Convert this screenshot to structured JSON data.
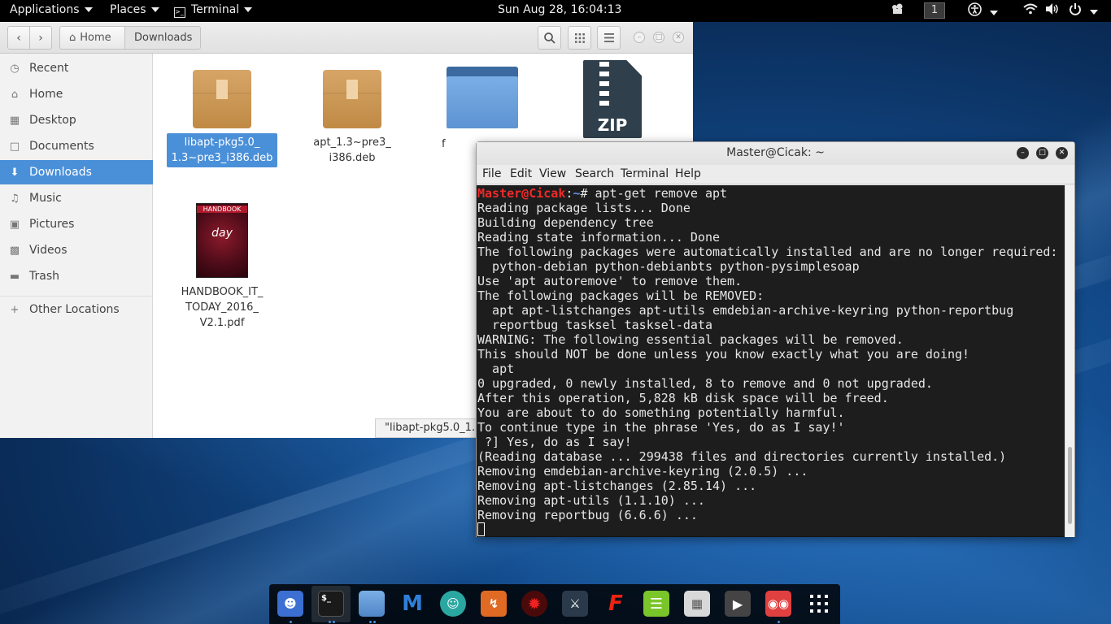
{
  "topbar": {
    "applications": "Applications",
    "places": "Places",
    "terminal": "Terminal",
    "clock": "Sun Aug 28, 16:04:13",
    "workspace": "1"
  },
  "filemanager": {
    "path": [
      "Home",
      "Downloads"
    ],
    "sidebar": [
      {
        "label": "Recent",
        "icon": "clock-icon"
      },
      {
        "label": "Home",
        "icon": "home-icon"
      },
      {
        "label": "Desktop",
        "icon": "desktop-folder-icon"
      },
      {
        "label": "Documents",
        "icon": "document-icon"
      },
      {
        "label": "Downloads",
        "icon": "download-icon",
        "active": true
      },
      {
        "label": "Music",
        "icon": "music-icon"
      },
      {
        "label": "Pictures",
        "icon": "picture-icon"
      },
      {
        "label": "Videos",
        "icon": "video-icon"
      },
      {
        "label": "Trash",
        "icon": "trash-icon"
      },
      {
        "label": "Other Locations",
        "icon": "plus-icon"
      }
    ],
    "files": [
      {
        "name": "libapt-pkg5.0_1.3~pre3_i386.deb",
        "lines": [
          "libapt-pkg5.0_",
          "1.3~pre3_i386.deb"
        ],
        "type": "package",
        "selected": true
      },
      {
        "name": "apt_1.3~pre3_i386.deb",
        "lines": [
          "apt_1.3~pre3_",
          "i386.deb"
        ],
        "type": "package"
      },
      {
        "name": "f",
        "lines": [
          "f"
        ],
        "type": "folder"
      },
      {
        "name": "",
        "lines": [],
        "type": "zip"
      },
      {
        "name": "HANDBOOK_IT_TODAY_2016_V2.1.pdf",
        "lines": [
          "HANDBOOK_IT_",
          "TODAY_2016_",
          "V2.1.pdf"
        ],
        "type": "pdf"
      }
    ],
    "status": "\"libapt-pkg5.0_1."
  },
  "terminal": {
    "title": "Master@Cicak: ~",
    "menu": [
      "File",
      "Edit",
      "View",
      "Search",
      "Terminal",
      "Help"
    ],
    "prompt_user": "Master@Cicak",
    "prompt_path": "~",
    "command": "# apt-get remove apt",
    "lines": [
      "Reading package lists... Done",
      "Building dependency tree",
      "Reading state information... Done",
      "The following packages were automatically installed and are no longer required:",
      "  python-debian python-debianbts python-pysimplesoap",
      "Use 'apt autoremove' to remove them.",
      "The following packages will be REMOVED:",
      "  apt apt-listchanges apt-utils emdebian-archive-keyring python-reportbug",
      "  reportbug tasksel tasksel-data",
      "WARNING: The following essential packages will be removed.",
      "This should NOT be done unless you know exactly what you are doing!",
      "  apt",
      "0 upgraded, 0 newly installed, 8 to remove and 0 not upgraded.",
      "After this operation, 5,828 kB disk space will be freed.",
      "You are about to do something potentially harmful.",
      "To continue type in the phrase 'Yes, do as I say!'",
      " ?] Yes, do as I say!",
      "(Reading database ... 299438 files and directories currently installed.)",
      "Removing emdebian-archive-keyring (2.0.5) ...",
      "Removing apt-listchanges (2.85.14) ...",
      "Removing apt-utils (1.1.10) ...",
      "Removing reportbug (6.6.6) ..."
    ]
  },
  "dock": [
    "pidgin-icon",
    "terminal-icon",
    "files-icon",
    "metasploit-icon",
    "anime-avatar-icon",
    "burpsuite-icon",
    "armitage-icon",
    "kali-dragon-icon",
    "faraday-icon",
    "notes-icon",
    "dictionary-icon",
    "player-icon",
    "glasses-icon",
    "app-grid-icon"
  ]
}
